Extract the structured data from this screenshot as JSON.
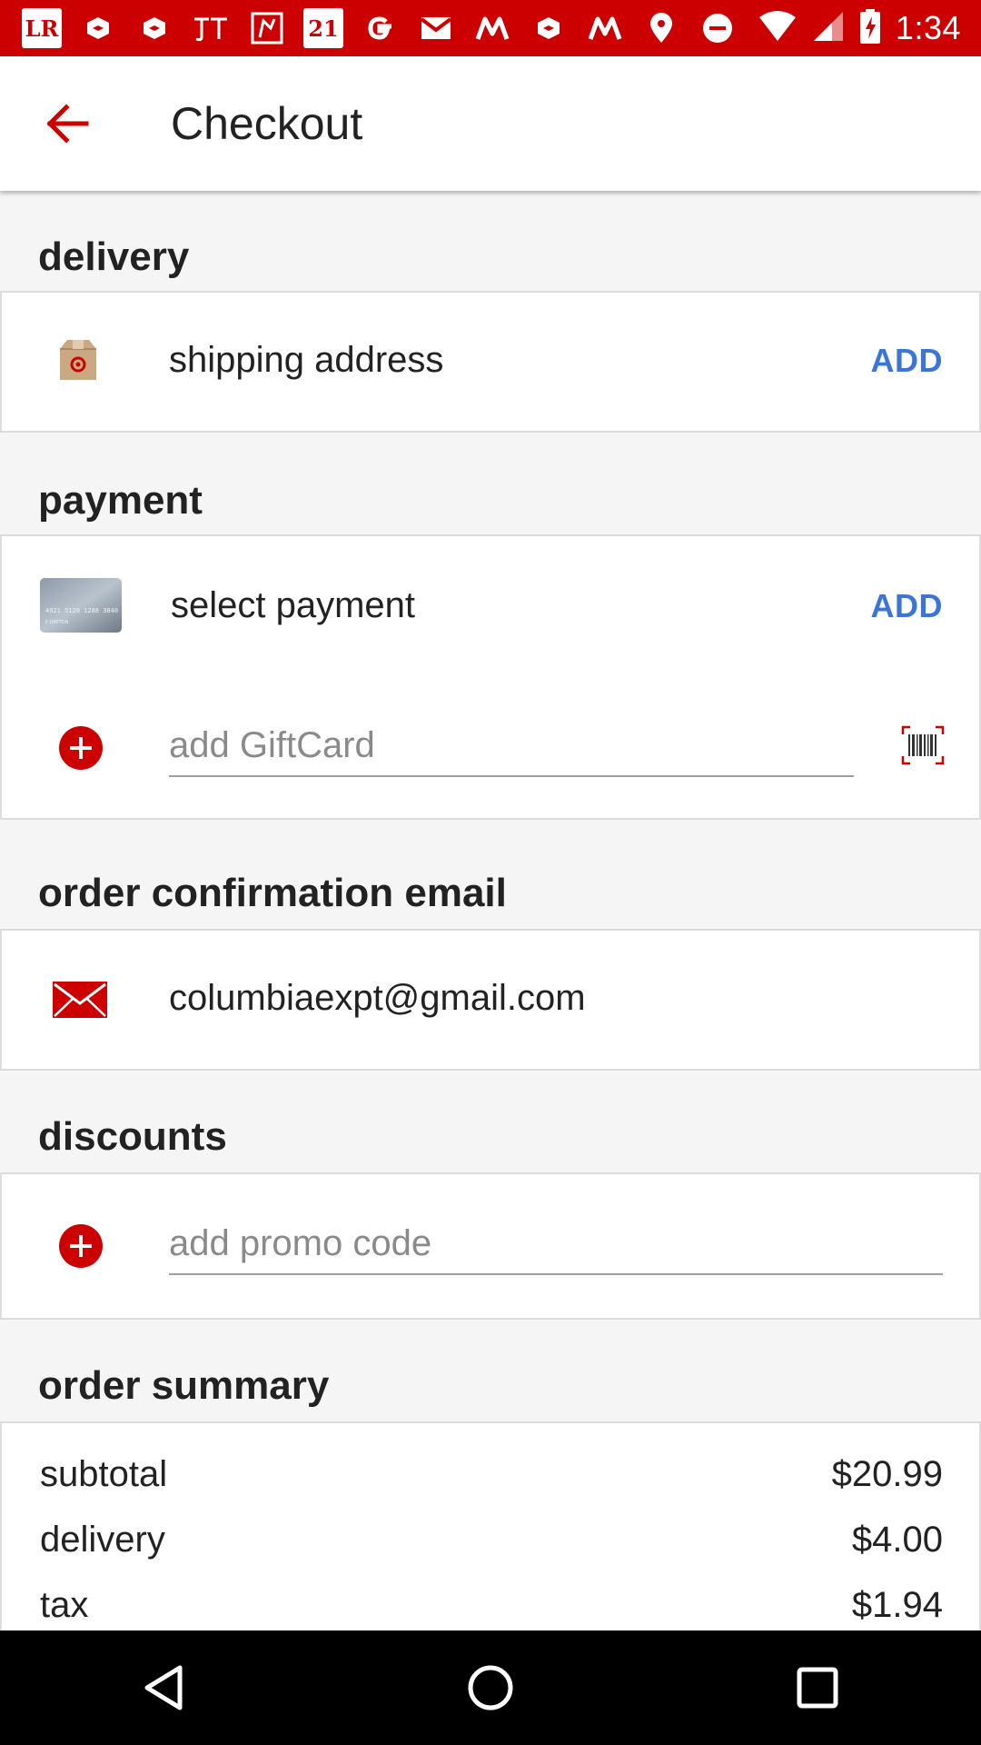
{
  "status_bar": {
    "time": "1:34",
    "left_icons": [
      "LR",
      "21"
    ],
    "left_icon_names": [
      "lightroom-icon",
      "cast-icon",
      "cast-icon",
      "jt-icon",
      "brand-icon",
      "forever21-icon",
      "google-icon",
      "gmail-icon",
      "m-icon",
      "cast-icon",
      "m-icon",
      "location-icon",
      "dnd-icon"
    ],
    "background": "#cc0000"
  },
  "app_bar": {
    "title": "Checkout"
  },
  "delivery": {
    "label": "delivery",
    "shipping_text": "shipping address",
    "add_label": "ADD"
  },
  "payment": {
    "label": "payment",
    "select_text": "select payment",
    "add_label": "ADD",
    "card_number": "4021 5120 1288 3840",
    "card_name": "E DAYTON",
    "giftcard_placeholder": "add GiftCard"
  },
  "email": {
    "label": "order confirmation email",
    "value": "columbiaexpt@gmail.com"
  },
  "discounts": {
    "label": "discounts",
    "promo_placeholder": "add promo code"
  },
  "summary": {
    "label": "order summary",
    "rows": [
      {
        "label": "subtotal",
        "value": "$20.99"
      },
      {
        "label": "delivery",
        "value": "$4.00"
      },
      {
        "label": "tax",
        "value": "$1.94"
      }
    ]
  },
  "colors": {
    "accent": "#cc0000",
    "link": "#3b76d6"
  }
}
